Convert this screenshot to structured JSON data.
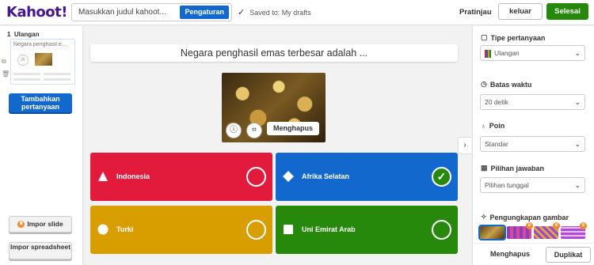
{
  "header": {
    "logo": "Kahoot!",
    "title_placeholder": "Masukkan judul kahoot...",
    "settings_label": "Pengaturan",
    "saved_text": "Saved to: My drafts",
    "preview_label": "Pratinjau",
    "exit_label": "keluar",
    "done_label": "Selesai"
  },
  "sidebar": {
    "slide_number": "1",
    "slide_type": "Ulangan",
    "slide_preview_text": "Negara penghasil e...",
    "slide_timer": "20",
    "add_question_label": "Tambahkan pertanyaan",
    "import_slide_label": "Impor slide",
    "import_sheet_label": "Impor spreadsheet"
  },
  "question": {
    "text": "Negara penghasil emas terbesar adalah ...",
    "remove_media_label": "Menghapus"
  },
  "answers": [
    {
      "label": "Indonesia",
      "correct": false,
      "color": "#e21b3c",
      "shape": "triangle"
    },
    {
      "label": "Afrika Selatan",
      "correct": true,
      "color": "#1368ce",
      "shape": "diamond"
    },
    {
      "label": "Turki",
      "correct": false,
      "color": "#d89e00",
      "shape": "circle"
    },
    {
      "label": "Uni Emirat Arab",
      "correct": false,
      "color": "#26890c",
      "shape": "square"
    }
  ],
  "panel": {
    "question_type_label": "Tipe pertanyaan",
    "question_type_value": "Ulangan",
    "time_limit_label": "Batas waktu",
    "time_limit_value": "20 detik",
    "points_label": "Poin",
    "points_value": "Standar",
    "answer_options_label": "Pilihan jawaban",
    "answer_options_value": "Pilihan tunggal",
    "image_reveal_label": "Pengungkapan gambar",
    "delete_label": "Menghapus",
    "duplicate_label": "Duplikat"
  },
  "colors": {
    "brand": "#46178f",
    "primary_blue": "#1368ce",
    "done_green": "#26890c"
  }
}
